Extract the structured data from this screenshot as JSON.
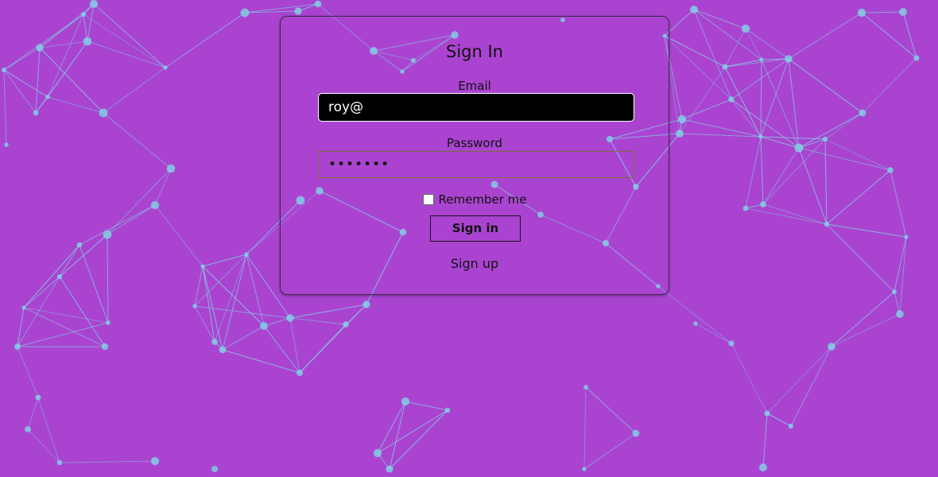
{
  "page": {
    "background_color": "#aa44d0",
    "network_color": "#7fd6e6"
  },
  "signin_form": {
    "title": "Sign In",
    "email_label": "Email",
    "email_value": "roy@",
    "password_label": "Password",
    "password_value": "•••••••",
    "remember_label": "Remember me",
    "remember_checked": false,
    "signin_button_label": "Sign in",
    "signup_link_label": "Sign up"
  }
}
